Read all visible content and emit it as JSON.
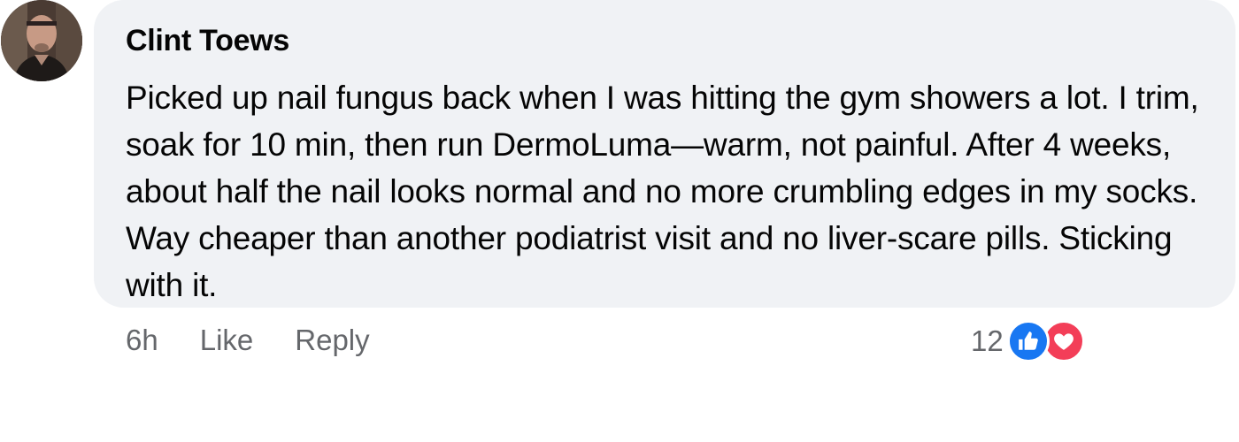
{
  "comment": {
    "author": "Clint Toews",
    "text": "Picked up nail fungus back when I was hitting the gym showers a lot. I trim, soak for 10 min, then run DermoLuma—warm, not painful. After 4 weeks, about half the nail looks normal and no more crumbling edges in my socks. Way cheaper than another podiatrist visit and no liver-scare pills. Sticking with it.",
    "timestamp": "6h",
    "like_label": "Like",
    "reply_label": "Reply",
    "reaction_count": "12",
    "reactions": [
      "like-icon",
      "love-icon"
    ]
  },
  "colors": {
    "bubble_bg": "#f0f2f5",
    "text": "#050505",
    "meta_text": "#65676b",
    "like_blue": "#1877f2",
    "love_red": "#f33e58"
  }
}
